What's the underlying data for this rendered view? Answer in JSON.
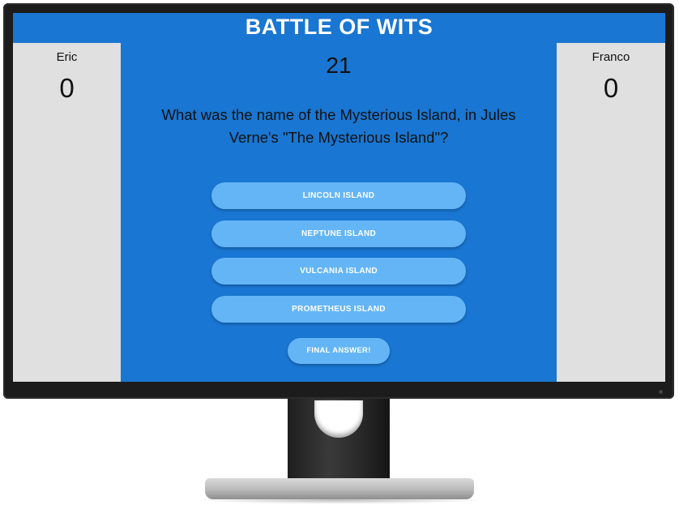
{
  "header": {
    "title": "BATTLE OF WITS"
  },
  "players": {
    "left": {
      "name": "Eric",
      "score": "0"
    },
    "right": {
      "name": "Franco",
      "score": "0"
    }
  },
  "game": {
    "timer": "21",
    "question": "What was the name of the Mysterious Island, in Jules Verne's \"The Mysterious Island\"?",
    "answers": [
      "LINCOLN ISLAND",
      "NEPTUNE ISLAND",
      "VULCANIA ISLAND",
      "PROMETHEUS ISLAND"
    ],
    "final_answer_label": "FINAL ANSWER!"
  },
  "colors": {
    "primary": "#1976d2",
    "button": "#64b5f6",
    "panel": "#e0e0e0"
  }
}
